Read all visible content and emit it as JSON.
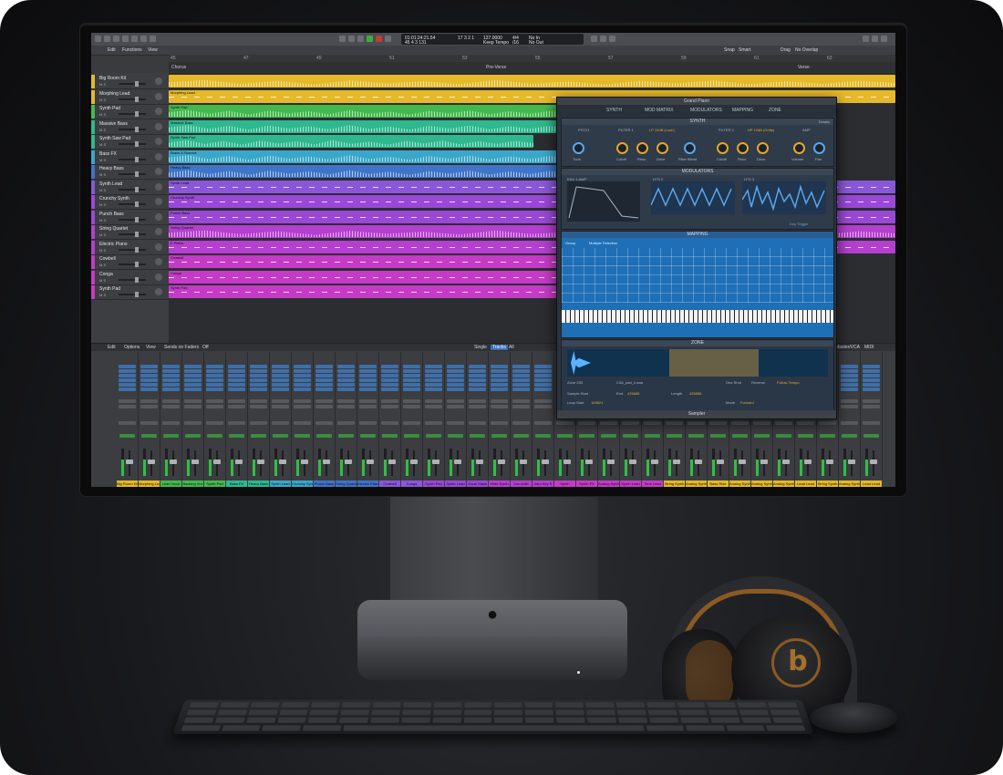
{
  "transport": {
    "position": "01:01:24:21.54",
    "bars": "45  4  3  131",
    "bars_end": "17  3  2  1",
    "tempo": "127.0000",
    "tempo_label": "Keep Tempo",
    "signature": "4/4",
    "division": "/16",
    "in_label": "No In",
    "out_label": "No Out"
  },
  "menubar": {
    "edit": "Edit",
    "functions": "Functions",
    "view": "View",
    "snap": "Snap",
    "snap_value": "Smart",
    "drag": "Drag",
    "drag_value": "No Overlap"
  },
  "ruler": [
    "45",
    "47",
    "49",
    "51",
    "53",
    "55",
    "57",
    "59",
    "61",
    "63"
  ],
  "markers": [
    "Chorus",
    "Pre-Verse",
    "Verse"
  ],
  "tracks": [
    {
      "name": "Big Room Kit",
      "color": "#e5b929",
      "region": "",
      "type": "wave",
      "start": 0,
      "end": 797
    },
    {
      "name": "Morphing Lead",
      "color": "#e5b929",
      "region": "Morphing Lead",
      "type": "midi",
      "start": 0,
      "end": 797
    },
    {
      "name": "Synth Pad",
      "color": "#43b94d",
      "region": "Synth Pad",
      "type": "wave",
      "start": 0,
      "end": 440
    },
    {
      "name": "Massive Bass",
      "color": "#2fb88f",
      "region": "Massive Bass",
      "type": "wave",
      "start": 0,
      "end": 440
    },
    {
      "name": "Synth Saw Pad",
      "color": "#2fb88f",
      "region": "Synth Saw Pad",
      "type": "wave",
      "start": 0,
      "end": 400
    },
    {
      "name": "Bass FX",
      "color": "#3aa7c9",
      "region": "Brass & Bounce",
      "type": "wave",
      "start": 0,
      "end": 440
    },
    {
      "name": "Heavy Bass",
      "color": "#3f74c9",
      "region": "Heavy Bass",
      "type": "wave",
      "start": 0,
      "end": 440
    },
    {
      "name": "Synth Lead",
      "color": "#8a57d9",
      "region": "Synth Lead",
      "type": "midi",
      "start": 0,
      "end": 797
    },
    {
      "name": "Crunchy Synth",
      "color": "#9a48d6",
      "region": "Crunchy Synth",
      "type": "midi",
      "start": 0,
      "end": 797
    },
    {
      "name": "Punch Bass",
      "color": "#9a48d6",
      "region": "Punch Bass",
      "type": "midi",
      "start": 0,
      "end": 797
    },
    {
      "name": "String Quartet",
      "color": "#b43fd0",
      "region": "String Quartet",
      "type": "wave",
      "start": 0,
      "end": 797
    },
    {
      "name": "Electric Piano",
      "color": "#b43fd0",
      "region": "E.Piano",
      "type": "midi",
      "start": 0,
      "end": 797
    },
    {
      "name": "Cowbell",
      "color": "#c53bc7",
      "region": "Cowbell",
      "type": "midi",
      "start": 0,
      "end": 440
    },
    {
      "name": "Conga",
      "color": "#c53bc7",
      "region": "Conga",
      "type": "midi",
      "start": 0,
      "end": 440
    },
    {
      "name": "Synth Pad",
      "color": "#c53bc7",
      "region": "Synth Pad",
      "type": "midi",
      "start": 0,
      "end": 440
    }
  ],
  "mixer": {
    "menu": [
      "Edit",
      "Options",
      "View",
      "Sends on Faders",
      "Off"
    ],
    "views": [
      "Single",
      "Tracks",
      "All"
    ],
    "right": [
      "Master/VCA",
      "MIDI"
    ],
    "strips": [
      {
        "name": "Big Room Kit",
        "color": "#e5b929"
      },
      {
        "name": "Morphing Lead",
        "color": "#e5b929"
      },
      {
        "name": "Lead Vocal",
        "color": "#43b94d"
      },
      {
        "name": "Backing Vox",
        "color": "#43b94d"
      },
      {
        "name": "Synth Pad",
        "color": "#43b94d"
      },
      {
        "name": "Bass FX",
        "color": "#2fb88f"
      },
      {
        "name": "Heavy Bass",
        "color": "#2fb88f"
      },
      {
        "name": "Synth Lead",
        "color": "#3aa7c9"
      },
      {
        "name": "Crunchy Synth",
        "color": "#3aa7c9"
      },
      {
        "name": "Punch Bass",
        "color": "#3f74c9"
      },
      {
        "name": "String Quartet",
        "color": "#3f74c9"
      },
      {
        "name": "Electric Piano",
        "color": "#3f74c9"
      },
      {
        "name": "Cowbell",
        "color": "#8a57d9"
      },
      {
        "name": "Conga",
        "color": "#8a57d9"
      },
      {
        "name": "Synth Pad",
        "color": "#9a48d6"
      },
      {
        "name": "Synth Lead",
        "color": "#9a48d6"
      },
      {
        "name": "Vocal Stack",
        "color": "#9a48d6"
      },
      {
        "name": "Wide Synth",
        "color": "#b43fd0"
      },
      {
        "name": "Vox Adlib",
        "color": "#b43fd0"
      },
      {
        "name": "Intro Key S",
        "color": "#b43fd0"
      },
      {
        "name": "Synth",
        "color": "#c53bc7"
      },
      {
        "name": "Synth FX",
        "color": "#c53bc7"
      },
      {
        "name": "Analog Synth",
        "color": "#c53bc7"
      },
      {
        "name": "Synth Lead",
        "color": "#c53bc7"
      },
      {
        "name": "Tone Lead",
        "color": "#c53bc7"
      },
      {
        "name": "String Synth",
        "color": "#e5b929"
      },
      {
        "name": "Analog Synth",
        "color": "#e5b929"
      },
      {
        "name": "Bass Ride",
        "color": "#e5b929"
      },
      {
        "name": "Analog Synth",
        "color": "#e5b929"
      },
      {
        "name": "Analog Synth",
        "color": "#e5b929"
      },
      {
        "name": "Analog Synth",
        "color": "#e5b929"
      },
      {
        "name": "Lead Lead",
        "color": "#e5b929"
      },
      {
        "name": "String Synth",
        "color": "#e5b929"
      },
      {
        "name": "Analog Synth",
        "color": "#e5b929"
      },
      {
        "name": "Lead Lead",
        "color": "#e5b929"
      },
      {
        "name": "Analog Synth",
        "color": "#e5b929"
      }
    ]
  },
  "sampler": {
    "title": "Grand Piano",
    "footer": "Sampler",
    "tabs": [
      "SYNTH",
      "MOD MATRIX",
      "MODULATORS",
      "MAPPING",
      "ZONE"
    ],
    "synth_header": "SYNTH",
    "details": "Details",
    "pitch": "PITCH",
    "filter1": "FILTER 1",
    "filter1_type": "LP 12dB (Lush)",
    "filter2": "FILTER 2",
    "filter2_type": "HP 12dB (Gritty)",
    "amp": "AMP",
    "knobs": [
      "Tune",
      "Cutoff",
      "Reso",
      "Drive",
      "Filter Blend",
      "Cutoff",
      "Reso",
      "Drive",
      "Volume",
      "Pan"
    ],
    "mod_header": "MODULATORS",
    "env": "ENV 1 AMP",
    "lfo2": "LFO 2",
    "lfo3": "LFO 3",
    "key_trigger": "Key Trigger",
    "map_header": "MAPPING",
    "map_group": "Group",
    "map_selection": "Multiple Selection",
    "zone_header": "ZONE",
    "zone": "Zone 235",
    "file": "C4A_pad_h.aaa",
    "pitch_label": "One Shot",
    "reverse": "Reverse",
    "follow_tempo": "Follow Tempo",
    "sample_start": "Sample Start",
    "end_label": "End",
    "end_value": "426885",
    "length_label": "Length",
    "length_value": "426885",
    "loop_start": "Loop Start",
    "loop_value": "169821",
    "mode": "Mode",
    "mode_value": "Forward"
  }
}
